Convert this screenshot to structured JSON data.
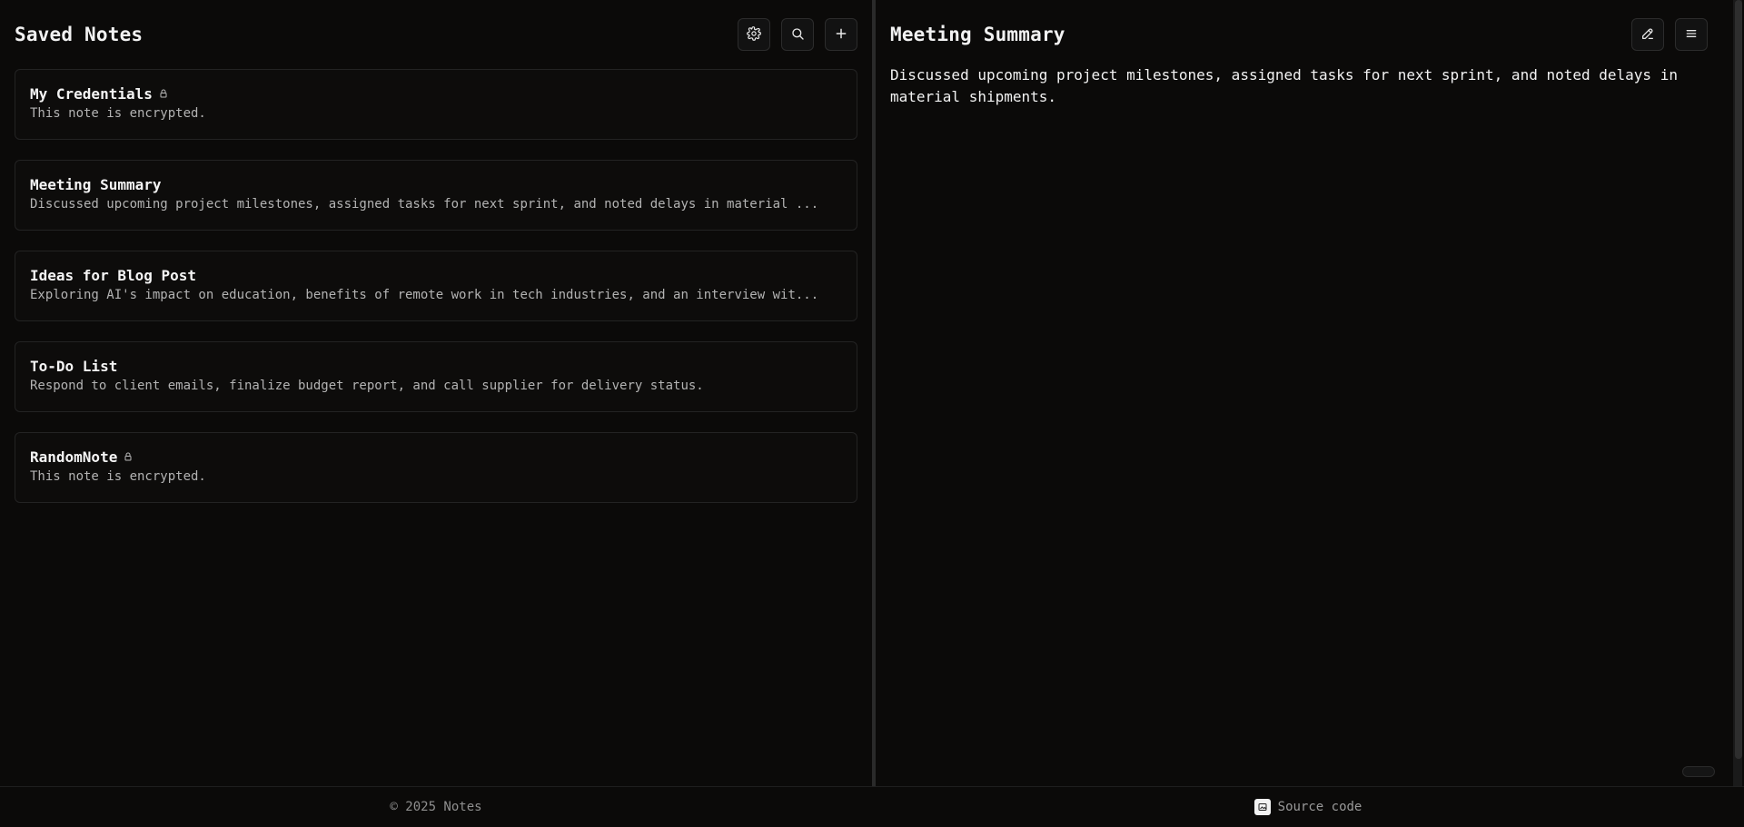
{
  "left": {
    "title": "Saved Notes",
    "buttons": {
      "settings": "settings",
      "search": "search",
      "add": "add"
    },
    "notes": [
      {
        "title": "My Credentials",
        "preview": "This note is encrypted.",
        "locked": true
      },
      {
        "title": "Meeting Summary",
        "preview": "Discussed upcoming project milestones, assigned tasks for next sprint, and noted delays in material ...",
        "locked": false
      },
      {
        "title": "Ideas for Blog Post",
        "preview": "Exploring AI's impact on education, benefits of remote work in tech industries, and an interview wit...",
        "locked": false
      },
      {
        "title": "To-Do List",
        "preview": "Respond to client emails, finalize budget report, and call supplier for delivery status.",
        "locked": false
      },
      {
        "title": "RandomNote",
        "preview": "This note is encrypted.",
        "locked": true
      }
    ]
  },
  "right": {
    "title": "Meeting Summary",
    "content": "Discussed upcoming project milestones, assigned tasks for next sprint, and noted delays in material shipments."
  },
  "footer": {
    "copyright": "© 2025 Notes",
    "source_label": "Source code"
  },
  "icons": {
    "settings": "gear-icon",
    "search": "search-icon",
    "add": "plus-icon",
    "edit": "edit-icon",
    "menu": "menu-icon",
    "lock": "lock-icon",
    "source": "image-icon"
  }
}
